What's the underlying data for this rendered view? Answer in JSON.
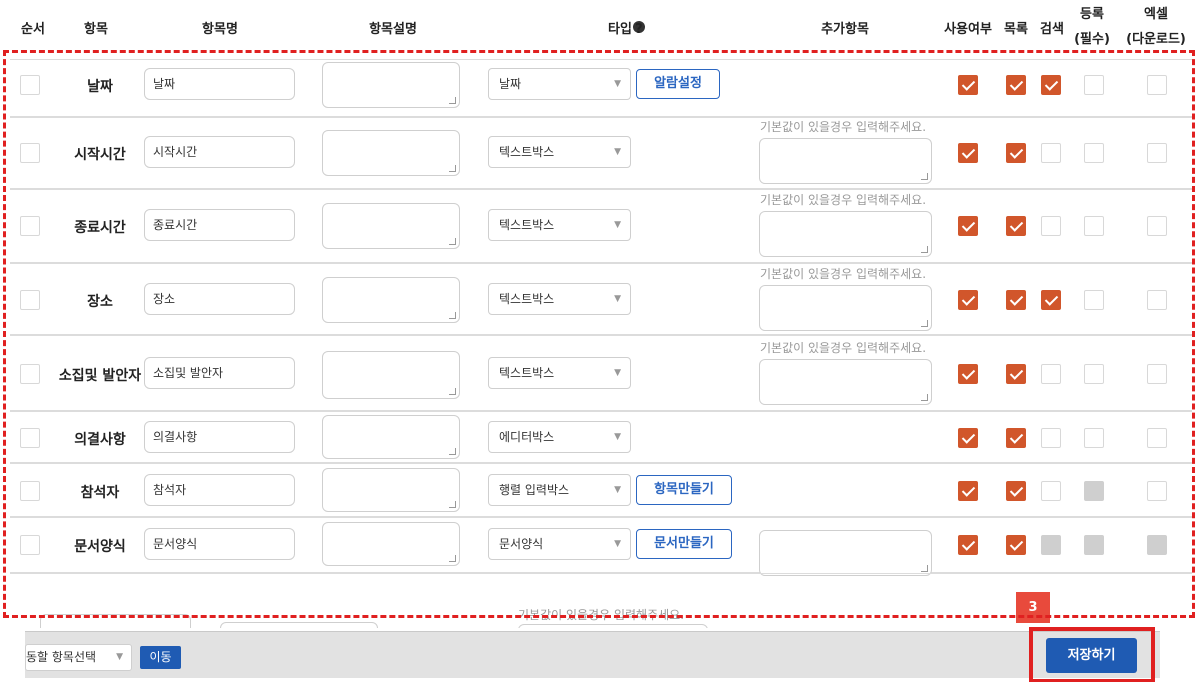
{
  "header": {
    "order": "순서",
    "item": "항목",
    "item_name": "항목명",
    "item_desc": "항목설명",
    "type": "타입",
    "extra": "추가항목",
    "use": "사용여부",
    "list": "목록",
    "search": "검색",
    "required_line1": "등록",
    "required_line2": "(필수)",
    "excel_line1": "엑셀",
    "excel_line2": "(다운로드)"
  },
  "rows": [
    {
      "label": "날짜",
      "value": "날짜",
      "type": "날짜",
      "button": "알람설정",
      "hint": "",
      "use": true,
      "list": true,
      "search": "on",
      "required": "off",
      "excel": "off"
    },
    {
      "label": "시작시간",
      "value": "시작시간",
      "type": "텍스트박스",
      "button": "",
      "hint": "기본값이 있을경우 입력해주세요.",
      "use": true,
      "list": true,
      "search": "off",
      "required": "off",
      "excel": "off"
    },
    {
      "label": "종료시간",
      "value": "종료시간",
      "type": "텍스트박스",
      "button": "",
      "hint": "기본값이 있을경우 입력해주세요.",
      "use": true,
      "list": true,
      "search": "off",
      "required": "off",
      "excel": "off"
    },
    {
      "label": "장소",
      "value": "장소",
      "type": "텍스트박스",
      "button": "",
      "hint": "기본값이 있을경우 입력해주세요.",
      "use": true,
      "list": true,
      "search": "on",
      "required": "off",
      "excel": "off"
    },
    {
      "label": "소집및 발안자",
      "value": "소집및 발안자",
      "type": "텍스트박스",
      "button": "",
      "hint": "기본값이 있을경우 입력해주세요.",
      "use": true,
      "list": true,
      "search": "off",
      "required": "off",
      "excel": "off"
    },
    {
      "label": "의결사항",
      "value": "의결사항",
      "type": "에디터박스",
      "button": "",
      "hint": "",
      "use": true,
      "list": true,
      "search": "off",
      "required": "off",
      "excel": "off"
    },
    {
      "label": "참석자",
      "value": "참석자",
      "type": "행렬 입력박스",
      "button": "항목만들기",
      "hint": "",
      "use": true,
      "list": true,
      "search": "off",
      "required": "disabled",
      "excel": "off"
    },
    {
      "label": "문서양식",
      "value": "문서양식",
      "type": "문서양식",
      "button": "문서만들기",
      "hint": "",
      "use": true,
      "list": true,
      "search": "disabled",
      "required": "disabled",
      "excel": "disabled"
    }
  ],
  "partial_row": {
    "hint": "기본값이 있을경우 입력해주세요."
  },
  "bottom": {
    "move_select": "동할 항목선택",
    "move_button": "이동",
    "save_button": "저장하기",
    "step_badge": "3"
  },
  "colors": {
    "checked": "#d1562b",
    "primary": "#1f5bb3",
    "highlight": "#e02020"
  }
}
